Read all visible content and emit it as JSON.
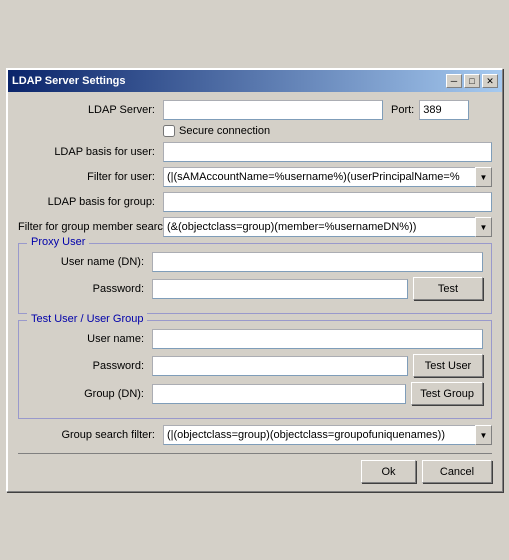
{
  "window": {
    "title": "LDAP Server Settings",
    "close_btn": "✕",
    "minimize_btn": "─",
    "maximize_btn": "□"
  },
  "form": {
    "ldap_server_label": "LDAP Server:",
    "ldap_server_value": "",
    "ldap_server_placeholder": "",
    "port_label": "Port:",
    "port_value": "389",
    "secure_label": "Secure connection",
    "ldap_basis_user_label": "LDAP basis for user:",
    "ldap_basis_user_value": "",
    "filter_user_label": "Filter for user:",
    "filter_user_value": "(|(sAMAccountName=%username%)(userPrincipalName=%",
    "ldap_basis_group_label": "LDAP basis for group:",
    "ldap_basis_group_value": "",
    "filter_group_label": "Filter for group member search:",
    "filter_group_value": "(&(objectclass=group)(member=%usernameDN%))"
  },
  "proxy_user": {
    "title": "Proxy User",
    "username_label": "User name (DN):",
    "username_value": "",
    "password_label": "Password:",
    "password_value": "",
    "test_btn": "Test"
  },
  "test_user_group": {
    "title": "Test User / User Group",
    "username_label": "User name:",
    "username_value": "",
    "password_label": "Password:",
    "password_value": "",
    "group_label": "Group (DN):",
    "group_value": "",
    "test_user_btn": "Test User",
    "test_group_btn": "Test Group"
  },
  "group_search": {
    "label": "Group search filter:",
    "value": "(|(objectclass=group)(objectclass=groupofuniquenames))"
  },
  "footer": {
    "ok_btn": "Ok",
    "cancel_btn": "Cancel"
  },
  "icons": {
    "dropdown_arrow": "▼",
    "checkbox_unchecked": "□"
  }
}
